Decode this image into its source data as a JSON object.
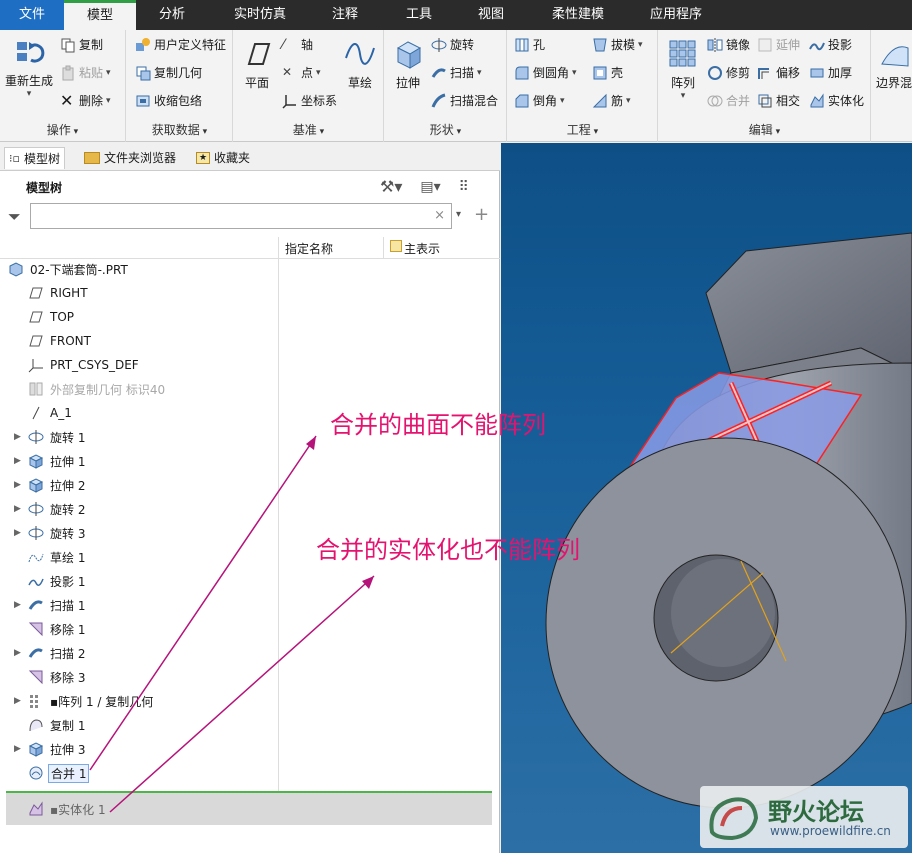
{
  "tabs": [
    "文件",
    "模型",
    "分析",
    "实时仿真",
    "注释",
    "工具",
    "视图",
    "柔性建模",
    "应用程序"
  ],
  "active_tab": "模型",
  "ribbon": {
    "operations": {
      "label": "操作",
      "regenerate": "重新生成",
      "copy": "复制",
      "paste": "粘贴",
      "delete": "删除"
    },
    "get_data": {
      "label": "获取数据",
      "udf": "用户定义特征",
      "copy_geom": "复制几何",
      "shrinkwrap": "收缩包络"
    },
    "datum": {
      "label": "基准",
      "plane": "平面",
      "axis": "轴",
      "point": "点",
      "csys": "坐标系",
      "sketch": "草绘"
    },
    "shapes": {
      "label": "形状",
      "extrude": "拉伸",
      "revolve": "旋转",
      "sweep": "扫描",
      "swept_blend": "扫描混合"
    },
    "engineering": {
      "label": "工程",
      "hole": "孔",
      "round": "倒圆角",
      "chamfer": "倒角",
      "draft": "拔模",
      "shell": "壳",
      "rib": "筋"
    },
    "editing": {
      "label": "编辑",
      "pattern": "阵列",
      "mirror": "镜像",
      "extend": "延伸",
      "project": "投影",
      "trim": "修剪",
      "offset": "偏移",
      "thicken": "加厚",
      "merge": "合并",
      "intersect": "相交",
      "solidify": "实体化"
    },
    "surfaces": {
      "boundary_blend": "边界混"
    }
  },
  "left_tabs": [
    "模型树",
    "文件夹浏览器",
    "收藏夹"
  ],
  "tree": {
    "title": "模型树",
    "search_value": "",
    "columns": [
      "指定名称",
      "主表示"
    ],
    "items": [
      {
        "label": "02-下端套筒-.PRT",
        "icon": "part-icon",
        "expand": false,
        "grey": false,
        "root": true
      },
      {
        "label": "RIGHT",
        "icon": "plane-icon",
        "expand": false,
        "grey": false
      },
      {
        "label": "TOP",
        "icon": "plane-icon",
        "expand": false,
        "grey": false
      },
      {
        "label": "FRONT",
        "icon": "plane-icon",
        "expand": false,
        "grey": false
      },
      {
        "label": "PRT_CSYS_DEF",
        "icon": "csys-icon",
        "expand": false,
        "grey": false
      },
      {
        "label": "外部复制几何 标识40",
        "icon": "external-copy-icon",
        "expand": false,
        "grey": true
      },
      {
        "label": "A_1",
        "icon": "axis-icon",
        "expand": false,
        "grey": false
      },
      {
        "label": "旋转 1",
        "icon": "revolve-icon",
        "expand": true,
        "grey": false
      },
      {
        "label": "拉伸 1",
        "icon": "extrude-icon",
        "expand": true,
        "grey": false
      },
      {
        "label": "拉伸 2",
        "icon": "extrude-icon",
        "expand": true,
        "grey": false
      },
      {
        "label": "旋转 2",
        "icon": "revolve-icon",
        "expand": true,
        "grey": false
      },
      {
        "label": "旋转 3",
        "icon": "revolve-icon",
        "expand": true,
        "grey": false
      },
      {
        "label": "草绘 1",
        "icon": "sketch-icon",
        "expand": false,
        "grey": false
      },
      {
        "label": "投影 1",
        "icon": "project-icon",
        "expand": false,
        "grey": false
      },
      {
        "label": "扫描 1",
        "icon": "sweep-icon",
        "expand": true,
        "grey": false
      },
      {
        "label": "移除 1",
        "icon": "remove-icon",
        "expand": false,
        "grey": false
      },
      {
        "label": "扫描 2",
        "icon": "sweep-icon",
        "expand": true,
        "grey": false
      },
      {
        "label": "移除 3",
        "icon": "remove-icon",
        "expand": false,
        "grey": false
      },
      {
        "label": "▪阵列 1 / 复制几何",
        "icon": "pattern-icon",
        "expand": true,
        "grey": false
      },
      {
        "label": "复制 1",
        "icon": "copy-icon",
        "expand": false,
        "grey": false
      },
      {
        "label": "拉伸 3",
        "icon": "extrude-icon",
        "expand": true,
        "grey": false
      },
      {
        "label": "合并 1",
        "icon": "merge-icon",
        "expand": false,
        "grey": false,
        "selected": true
      }
    ],
    "last_item": {
      "label": "▪实体化 1",
      "icon": "solidify-icon"
    }
  },
  "annotations": {
    "text1": "合并的曲面不能阵列",
    "text2": "合并的实体化也不能阵列",
    "color": "#e4136f"
  },
  "watermark": {
    "title": "野火论坛",
    "url": "www.proewildfire.cn"
  }
}
